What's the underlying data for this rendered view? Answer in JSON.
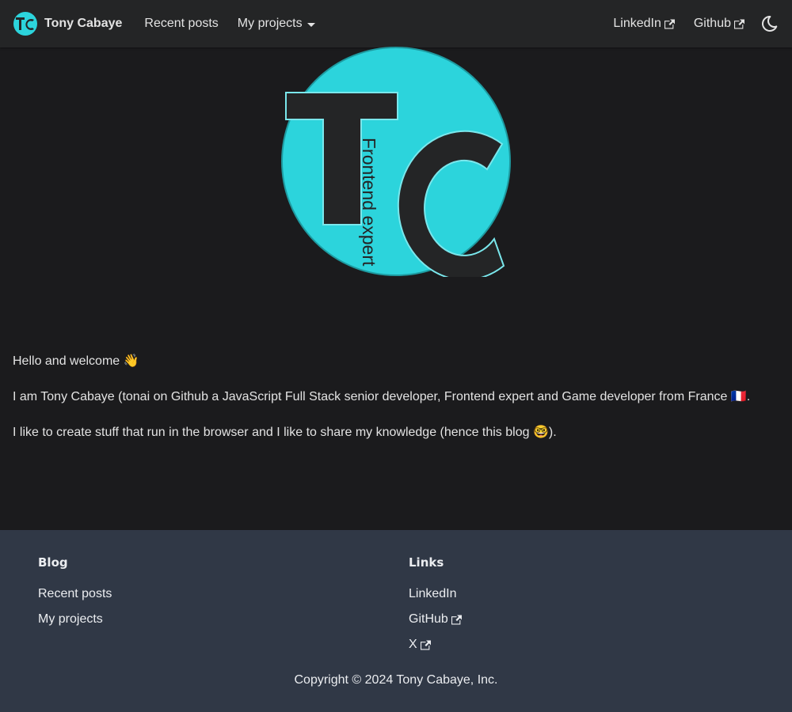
{
  "navbar": {
    "brand_title": "Tony Cabaye",
    "brand_logo_icon": "tc-logo-icon",
    "links": [
      {
        "label": "Recent posts"
      },
      {
        "label": "My projects"
      }
    ],
    "right_links": [
      {
        "label": "LinkedIn",
        "icon": "external-link-icon"
      },
      {
        "label": "Github",
        "icon": "external-link-icon"
      }
    ],
    "theme_toggle_icon": "moon-icon"
  },
  "hero": {
    "logo_text": "TC",
    "logo_tagline": "Frontend expert",
    "logo_colors": {
      "circle": "#2cd4dc",
      "letters": "#242526"
    }
  },
  "content": {
    "paragraphs": [
      "Hello and welcome 👋",
      "I am Tony Cabaye (tonai on Github a JavaScript Full Stack senior developer, Frontend expert and Game developer from France 🇫🇷.",
      "I like to create stuff that run in the browser and I like to share my knowledge (hence this blog 🤓)."
    ]
  },
  "footer": {
    "columns": [
      {
        "title": "Blog",
        "links": [
          {
            "label": "Recent posts",
            "external": false
          },
          {
            "label": "My projects",
            "external": false
          }
        ]
      },
      {
        "title": "Links",
        "links": [
          {
            "label": "LinkedIn",
            "external": false
          },
          {
            "label": "GitHub",
            "external": true
          },
          {
            "label": "X",
            "external": true
          }
        ]
      }
    ],
    "copyright": "Copyright © 2024 Tony Cabaye, Inc."
  },
  "colors": {
    "background": "#1b1b1d",
    "navbar": "#242526",
    "footer": "#303846",
    "accent": "#2cd4dc"
  }
}
